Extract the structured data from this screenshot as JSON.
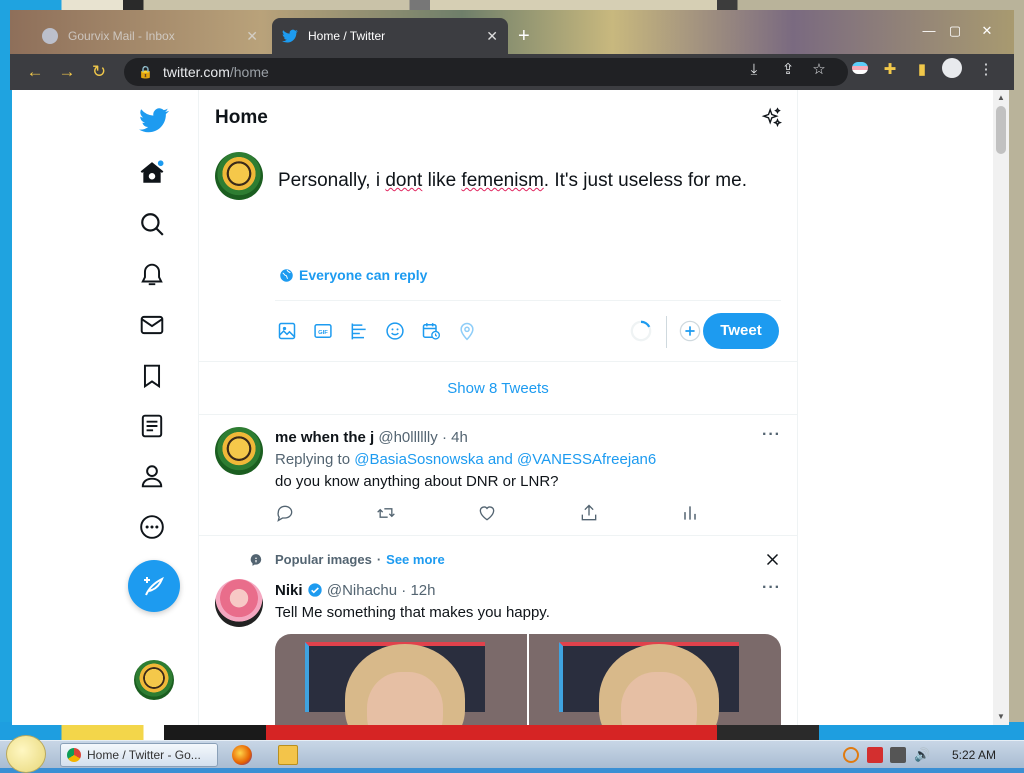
{
  "browser": {
    "tabs": [
      {
        "title": "Gourvix Mail - Inbox",
        "active": false
      },
      {
        "title": "Home / Twitter",
        "active": true
      }
    ],
    "url_host": "twitter.com",
    "url_path": "/home"
  },
  "twitter": {
    "header_title": "Home",
    "compose": {
      "text_before": "Personally, i ",
      "misspelled_1": "dont",
      "text_mid": " like ",
      "misspelled_2": "femenism",
      "text_after": ". It's just useless for me.",
      "reply_setting": "Everyone can reply",
      "tweet_button": "Tweet"
    },
    "show_tweets": "Show 8 Tweets",
    "tweet1": {
      "name": "me when the j",
      "handle": "@h0lllllly",
      "time": "4h",
      "replying_prefix": "Replying to ",
      "replying_to": "@BasiaSosnowska and @VANESSAfreejan6",
      "text": "do you know anything about DNR or LNR?"
    },
    "promo": {
      "label": "Popular images",
      "see_more": "See more"
    },
    "tweet2": {
      "name": "Niki",
      "handle": "@Nihachu",
      "time": "12h",
      "text": "Tell Me something that makes you happy."
    }
  },
  "taskbar": {
    "active_task": "Home / Twitter - Go...",
    "clock": "5:22 AM"
  },
  "colors": {
    "twitter_blue": "#1d9bf0",
    "chrome_dark": "#3c3d41"
  }
}
